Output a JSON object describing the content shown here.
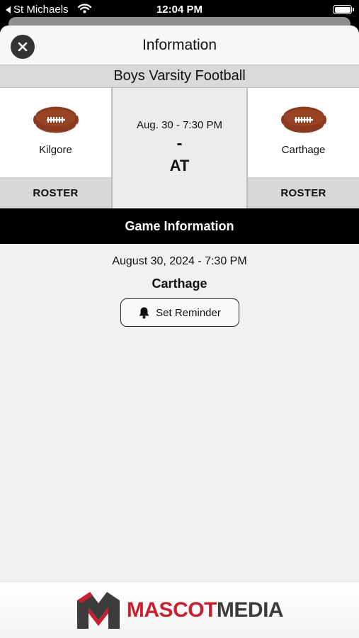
{
  "status_bar": {
    "back_label": "St Michaels",
    "time": "12:04 PM"
  },
  "modal": {
    "title": "Information"
  },
  "sport": "Boys Varsity Football",
  "game": {
    "home_team": "Kilgore",
    "away_team": "Carthage",
    "short_datetime": "Aug. 30 - 7:30 PM",
    "score": "-",
    "versus": "AT",
    "roster_label": "ROSTER"
  },
  "game_information": {
    "heading": "Game Information",
    "datetime": "August 30, 2024 - 7:30 PM",
    "location": "Carthage",
    "reminder_label": "Set Reminder"
  },
  "footer": {
    "brand_part1": "MASCOT",
    "brand_part2": "MEDIA"
  },
  "colors": {
    "brand_red": "#c8202f",
    "brand_dark": "#3c3c3c",
    "football_brown": "#8b3a1f"
  },
  "icons": [
    "wifi-icon",
    "battery-icon",
    "close-icon",
    "football-icon",
    "bell-icon",
    "mascot-media-logo"
  ]
}
